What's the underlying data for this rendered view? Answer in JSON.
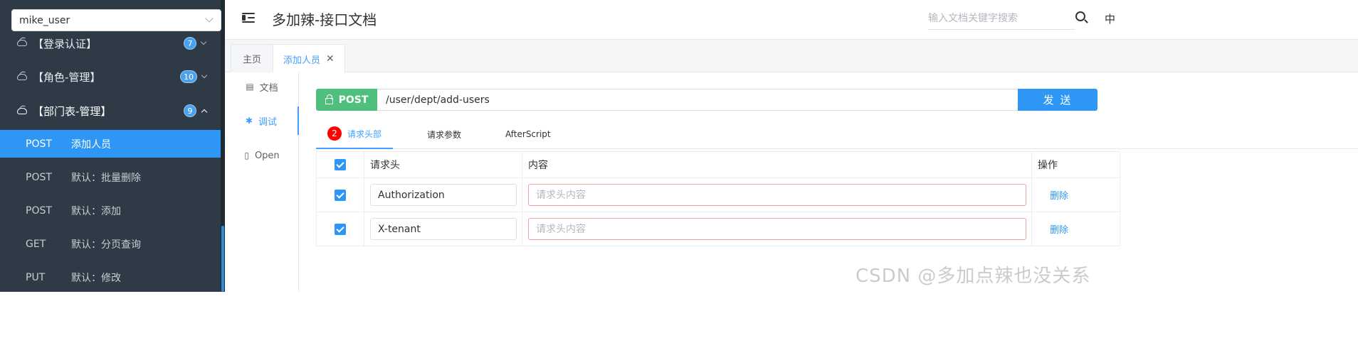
{
  "sidebar": {
    "project": "mike_user",
    "groups": [
      {
        "label": "【登录认证】",
        "badge": "7"
      },
      {
        "label": "【角色-管理】",
        "badge": "10"
      },
      {
        "label": "【部门表-管理】",
        "badge": "9"
      }
    ],
    "apis": [
      {
        "method": "POST",
        "name": "添加人员"
      },
      {
        "method": "POST",
        "name": "默认：批量删除"
      },
      {
        "method": "POST",
        "name": "默认：添加"
      },
      {
        "method": "GET",
        "name": "默认：分页查询"
      },
      {
        "method": "PUT",
        "name": "默认：修改"
      }
    ]
  },
  "header": {
    "title": "多加辣-接口文档",
    "search_placeholder": "输入文档关键字搜索",
    "lang": "中"
  },
  "tabs": [
    {
      "label": "主页"
    },
    {
      "label": "添加人员"
    }
  ],
  "subnav": [
    {
      "label": "文档"
    },
    {
      "label": "调试"
    },
    {
      "label": "Open"
    }
  ],
  "request": {
    "method": "POST",
    "url": "/user/dept/add-users",
    "send_label": "发 送"
  },
  "req_tabs": {
    "headers_label": "请求头部",
    "headers_count": "2",
    "params_label": "请求参数",
    "afterscript_label": "AfterScript"
  },
  "header_table": {
    "columns": [
      "请求头",
      "内容",
      "操作"
    ],
    "rows": [
      {
        "name": "Authorization",
        "placeholder": "请求头内容",
        "action": "删除"
      },
      {
        "name": "X-tenant",
        "placeholder": "请求头内容",
        "action": "删除"
      }
    ]
  },
  "watermark": "CSDN @多加点辣也没关系",
  "colors": {
    "accent": "#2e97f5",
    "post": "#4fbf7d",
    "sidebar": "#2e3b46",
    "badge_red": "#ff0000"
  }
}
